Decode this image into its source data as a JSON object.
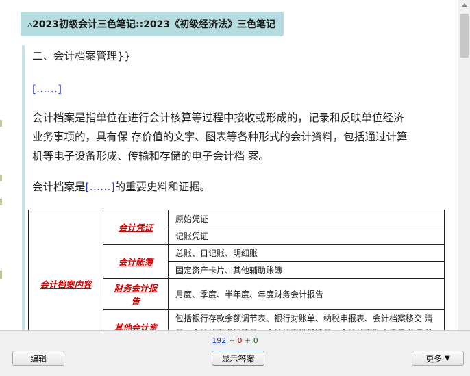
{
  "deck_title": "▵2023初级会计三色笔记::2023《初级经济法》三色笔记",
  "card": {
    "heading": "二、会计档案管理}}",
    "cloze_line": "[……]",
    "paragraph_lines": [
      "会计档案是指单位在进行会计核算等过程中接收或形成的，记录和反映单位经济",
      "业务事项的，具有保  存价值的文字、图表等各种形式的会计资料，包括通过计算",
      "机等电子设备形成、传输和存储的电子会计档  案。"
    ],
    "sentence_prefix": "会计档案是",
    "sentence_cloze": "[……]",
    "sentence_suffix": "的重要史料和证据。",
    "table": {
      "root_label": "会计档案内容",
      "groups": [
        {
          "label": "会计凭证",
          "items": [
            "原始凭证",
            "记账凭证"
          ]
        },
        {
          "label": "会计账簿",
          "items": [
            "总账、日记账、明细账",
            "固定资产卡片、其他辅助账簿"
          ]
        },
        {
          "label": "财务会计报告",
          "items": [
            "月度、季度、半年度、年度财务会计报告"
          ]
        },
        {
          "label": "其他会计资料",
          "items": [
            "包括银行存款余额调节表、银行对账单、纳税申报表、会计档案移交  清册、会计档案保管清册、会计档案销毁清册、会计档案鉴定意见书  及其他具有保存价值的会计资料"
          ]
        }
      ]
    }
  },
  "counts": {
    "new": "192",
    "sep1": "+",
    "learning": "0",
    "sep2": "+",
    "review": "0"
  },
  "buttons": {
    "edit": "编辑",
    "show_answer": "显示答案",
    "more": "更多",
    "more_arrow": "▼"
  }
}
